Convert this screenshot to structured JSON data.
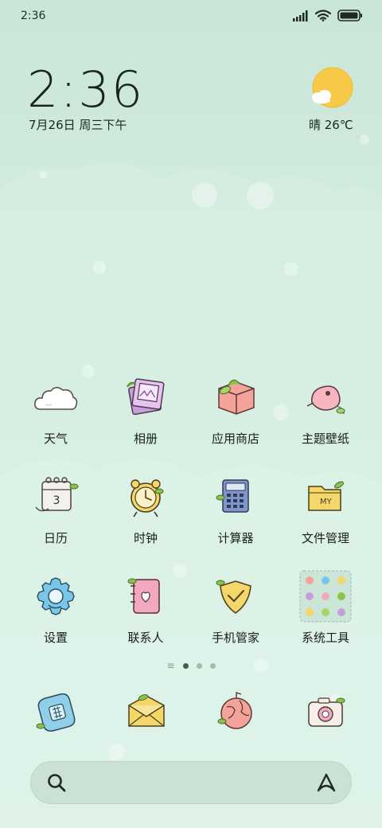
{
  "status_bar": {
    "time": "2:36"
  },
  "home": {
    "clock": "2:36",
    "date": "7月26日 周三下午",
    "weather": "晴 26℃"
  },
  "apps": [
    {
      "label": "天气",
      "icon": "cloud-icon"
    },
    {
      "label": "相册",
      "icon": "photo-album-icon"
    },
    {
      "label": "应用商店",
      "icon": "app-store-box-icon"
    },
    {
      "label": "主题壁纸",
      "icon": "themes-icon"
    },
    {
      "label": "日历",
      "icon": "calendar-icon"
    },
    {
      "label": "时钟",
      "icon": "alarm-clock-icon"
    },
    {
      "label": "计算器",
      "icon": "calculator-icon"
    },
    {
      "label": "文件管理",
      "icon": "folder-icon"
    },
    {
      "label": "设置",
      "icon": "gear-icon"
    },
    {
      "label": "联系人",
      "icon": "contacts-book-icon"
    },
    {
      "label": "手机管家",
      "icon": "shield-icon"
    },
    {
      "label": "系统工具",
      "icon": "folder-grid-icon"
    }
  ],
  "dock": [
    {
      "icon": "phone-icon"
    },
    {
      "icon": "messages-envelope-icon"
    },
    {
      "icon": "browser-globe-icon"
    },
    {
      "icon": "camera-icon"
    }
  ],
  "pager": {
    "pages": 3,
    "current": 1
  },
  "colors": {
    "accent": "#f7c948",
    "background": "#d3ece0"
  }
}
